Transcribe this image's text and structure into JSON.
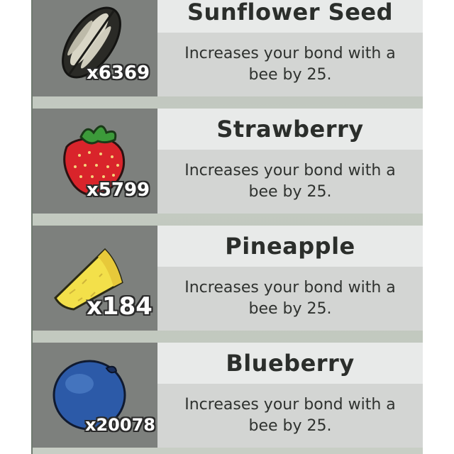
{
  "items": [
    {
      "name": "Sunflower Seed",
      "description": "Increases your bond with a bee by 25.",
      "count": "x6369",
      "icon": "sunflower-seed-icon"
    },
    {
      "name": "Strawberry",
      "description": "Increases your bond with a bee by 25.",
      "count": "x5799",
      "icon": "strawberry-icon"
    },
    {
      "name": "Pineapple",
      "description": "Increases your bond with a bee by 25.",
      "count": "x184",
      "icon": "pineapple-icon"
    },
    {
      "name": "Blueberry",
      "description": "Increases your bond with a bee by 25.",
      "count": "x20078",
      "icon": "blueberry-icon"
    }
  ],
  "colors": {
    "icon_cell": "#7d807d",
    "title_bar": "#e8eae9",
    "desc_box": "#d3d5d3",
    "text": "#2b2e2b"
  }
}
